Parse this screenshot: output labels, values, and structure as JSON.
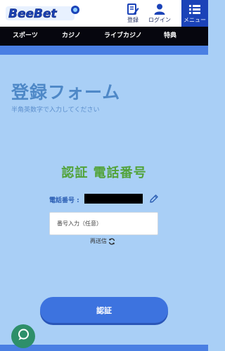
{
  "header": {
    "logo_text": "BeeBet",
    "register_label": "登録",
    "login_label": "ログイン",
    "menu_label": "メニュー"
  },
  "nav": {
    "items": [
      {
        "label": "スポーツ"
      },
      {
        "label": "カジノ"
      },
      {
        "label": "ライブカジノ"
      },
      {
        "label": "特典"
      }
    ]
  },
  "form": {
    "title": "登録フォーム",
    "subtitle": "半角英数字で入力してください",
    "auth_heading": "認証 電話番号",
    "phone_label": "電話番号 :",
    "code_placeholder": "番号入力（任意）",
    "resend_label": "再送信",
    "submit_label": "認証"
  },
  "icons": {
    "register": "edit-document-icon",
    "login": "user-icon",
    "menu": "list-menu-icon",
    "edit_phone": "pencil-icon",
    "resend": "refresh-icon",
    "chat": "chat-bubble-icon"
  },
  "colors": {
    "page_background": "#a9cff6",
    "header_background": "#ffffff",
    "nav_background": "#06060e",
    "menu_button": "#1b43b8",
    "accent_blue": "#4a7fe3",
    "title_color": "#4e88c7",
    "heading_green": "#52a33a",
    "submit_button": "#3d73df",
    "chat_button": "#2e8f6a"
  }
}
